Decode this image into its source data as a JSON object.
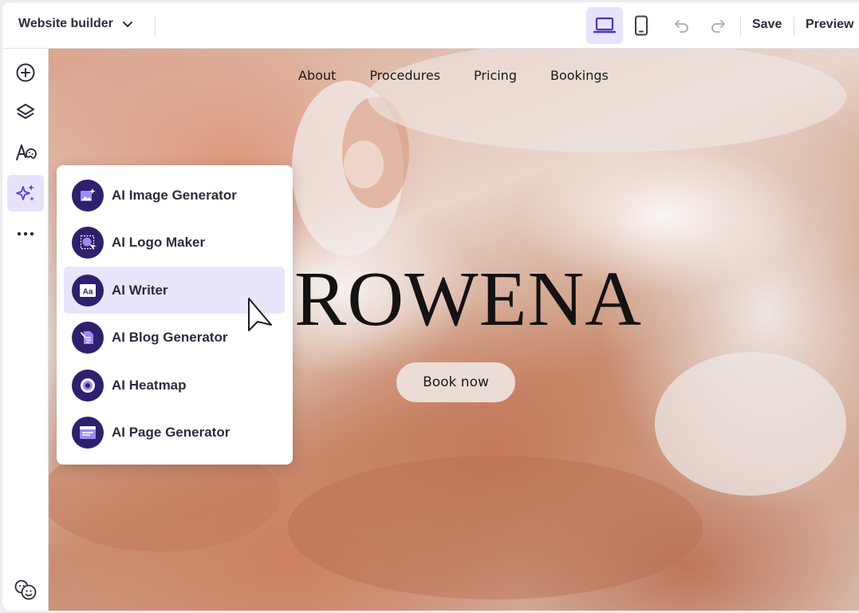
{
  "topbar": {
    "site_select_label": "Website builder",
    "save_label": "Save",
    "preview_label": "Preview",
    "active_device": "desktop",
    "icons": [
      "chevron-down-icon",
      "desktop-icon",
      "mobile-icon",
      "undo-icon",
      "redo-icon"
    ]
  },
  "rail": {
    "active_tool": "ai-tools",
    "items": [
      "add-icon",
      "layers-icon",
      "design-icon",
      "ai-sparkle-icon",
      "more-icon"
    ],
    "footer_icon": "emoji-feedback-icon"
  },
  "site": {
    "nav": [
      "About",
      "Procedures",
      "Pricing",
      "Bookings"
    ],
    "title": "ROWENA",
    "cta_label": "Book now"
  },
  "ai_menu": {
    "items": [
      {
        "label": "AI Image Generator",
        "icon": "image-generator-icon"
      },
      {
        "label": "AI Logo Maker",
        "icon": "logo-maker-icon"
      },
      {
        "label": "AI Writer",
        "icon": "writer-icon"
      },
      {
        "label": "AI Blog Generator",
        "icon": "blog-generator-icon"
      },
      {
        "label": "AI Heatmap",
        "icon": "heatmap-icon"
      },
      {
        "label": "AI Page Generator",
        "icon": "page-generator-icon"
      }
    ],
    "hovered_item": "AI Writer"
  },
  "colors": {
    "accent": "#6b4fd8",
    "accent_soft": "#e7e3fb",
    "badge_bg": "#2f1f6d",
    "text": "#2c2c3c"
  }
}
